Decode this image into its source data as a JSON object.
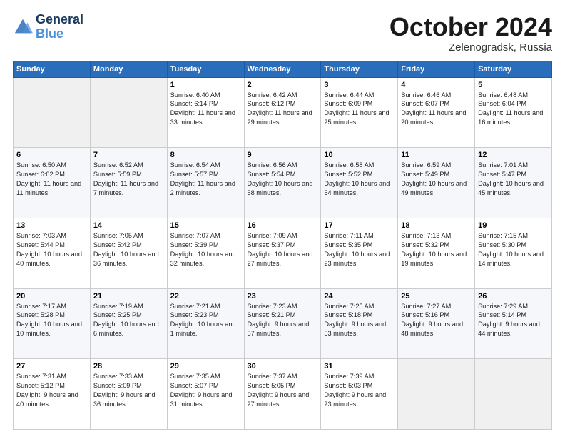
{
  "header": {
    "logo_line1": "General",
    "logo_line2": "Blue",
    "month": "October 2024",
    "location": "Zelenogradsk, Russia"
  },
  "days_of_week": [
    "Sunday",
    "Monday",
    "Tuesday",
    "Wednesday",
    "Thursday",
    "Friday",
    "Saturday"
  ],
  "weeks": [
    [
      {
        "num": "",
        "info": ""
      },
      {
        "num": "",
        "info": ""
      },
      {
        "num": "1",
        "info": "Sunrise: 6:40 AM\nSunset: 6:14 PM\nDaylight: 11 hours and 33 minutes."
      },
      {
        "num": "2",
        "info": "Sunrise: 6:42 AM\nSunset: 6:12 PM\nDaylight: 11 hours and 29 minutes."
      },
      {
        "num": "3",
        "info": "Sunrise: 6:44 AM\nSunset: 6:09 PM\nDaylight: 11 hours and 25 minutes."
      },
      {
        "num": "4",
        "info": "Sunrise: 6:46 AM\nSunset: 6:07 PM\nDaylight: 11 hours and 20 minutes."
      },
      {
        "num": "5",
        "info": "Sunrise: 6:48 AM\nSunset: 6:04 PM\nDaylight: 11 hours and 16 minutes."
      }
    ],
    [
      {
        "num": "6",
        "info": "Sunrise: 6:50 AM\nSunset: 6:02 PM\nDaylight: 11 hours and 11 minutes."
      },
      {
        "num": "7",
        "info": "Sunrise: 6:52 AM\nSunset: 5:59 PM\nDaylight: 11 hours and 7 minutes."
      },
      {
        "num": "8",
        "info": "Sunrise: 6:54 AM\nSunset: 5:57 PM\nDaylight: 11 hours and 2 minutes."
      },
      {
        "num": "9",
        "info": "Sunrise: 6:56 AM\nSunset: 5:54 PM\nDaylight: 10 hours and 58 minutes."
      },
      {
        "num": "10",
        "info": "Sunrise: 6:58 AM\nSunset: 5:52 PM\nDaylight: 10 hours and 54 minutes."
      },
      {
        "num": "11",
        "info": "Sunrise: 6:59 AM\nSunset: 5:49 PM\nDaylight: 10 hours and 49 minutes."
      },
      {
        "num": "12",
        "info": "Sunrise: 7:01 AM\nSunset: 5:47 PM\nDaylight: 10 hours and 45 minutes."
      }
    ],
    [
      {
        "num": "13",
        "info": "Sunrise: 7:03 AM\nSunset: 5:44 PM\nDaylight: 10 hours and 40 minutes."
      },
      {
        "num": "14",
        "info": "Sunrise: 7:05 AM\nSunset: 5:42 PM\nDaylight: 10 hours and 36 minutes."
      },
      {
        "num": "15",
        "info": "Sunrise: 7:07 AM\nSunset: 5:39 PM\nDaylight: 10 hours and 32 minutes."
      },
      {
        "num": "16",
        "info": "Sunrise: 7:09 AM\nSunset: 5:37 PM\nDaylight: 10 hours and 27 minutes."
      },
      {
        "num": "17",
        "info": "Sunrise: 7:11 AM\nSunset: 5:35 PM\nDaylight: 10 hours and 23 minutes."
      },
      {
        "num": "18",
        "info": "Sunrise: 7:13 AM\nSunset: 5:32 PM\nDaylight: 10 hours and 19 minutes."
      },
      {
        "num": "19",
        "info": "Sunrise: 7:15 AM\nSunset: 5:30 PM\nDaylight: 10 hours and 14 minutes."
      }
    ],
    [
      {
        "num": "20",
        "info": "Sunrise: 7:17 AM\nSunset: 5:28 PM\nDaylight: 10 hours and 10 minutes."
      },
      {
        "num": "21",
        "info": "Sunrise: 7:19 AM\nSunset: 5:25 PM\nDaylight: 10 hours and 6 minutes."
      },
      {
        "num": "22",
        "info": "Sunrise: 7:21 AM\nSunset: 5:23 PM\nDaylight: 10 hours and 1 minute."
      },
      {
        "num": "23",
        "info": "Sunrise: 7:23 AM\nSunset: 5:21 PM\nDaylight: 9 hours and 57 minutes."
      },
      {
        "num": "24",
        "info": "Sunrise: 7:25 AM\nSunset: 5:18 PM\nDaylight: 9 hours and 53 minutes."
      },
      {
        "num": "25",
        "info": "Sunrise: 7:27 AM\nSunset: 5:16 PM\nDaylight: 9 hours and 48 minutes."
      },
      {
        "num": "26",
        "info": "Sunrise: 7:29 AM\nSunset: 5:14 PM\nDaylight: 9 hours and 44 minutes."
      }
    ],
    [
      {
        "num": "27",
        "info": "Sunrise: 7:31 AM\nSunset: 5:12 PM\nDaylight: 9 hours and 40 minutes."
      },
      {
        "num": "28",
        "info": "Sunrise: 7:33 AM\nSunset: 5:09 PM\nDaylight: 9 hours and 36 minutes."
      },
      {
        "num": "29",
        "info": "Sunrise: 7:35 AM\nSunset: 5:07 PM\nDaylight: 9 hours and 31 minutes."
      },
      {
        "num": "30",
        "info": "Sunrise: 7:37 AM\nSunset: 5:05 PM\nDaylight: 9 hours and 27 minutes."
      },
      {
        "num": "31",
        "info": "Sunrise: 7:39 AM\nSunset: 5:03 PM\nDaylight: 9 hours and 23 minutes."
      },
      {
        "num": "",
        "info": ""
      },
      {
        "num": "",
        "info": ""
      }
    ]
  ]
}
